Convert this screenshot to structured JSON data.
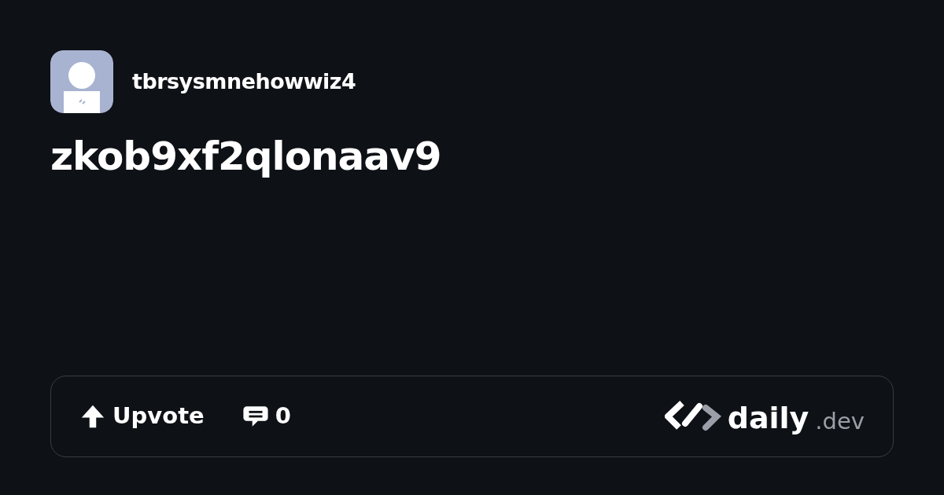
{
  "author": {
    "name": "tbrsysmnehowwiz4"
  },
  "title": "zkob9xf2qlonaav9",
  "footer": {
    "upvote": "Upvote",
    "comments": "0",
    "brand": {
      "name": "daily",
      "suffix": ".dev"
    }
  }
}
